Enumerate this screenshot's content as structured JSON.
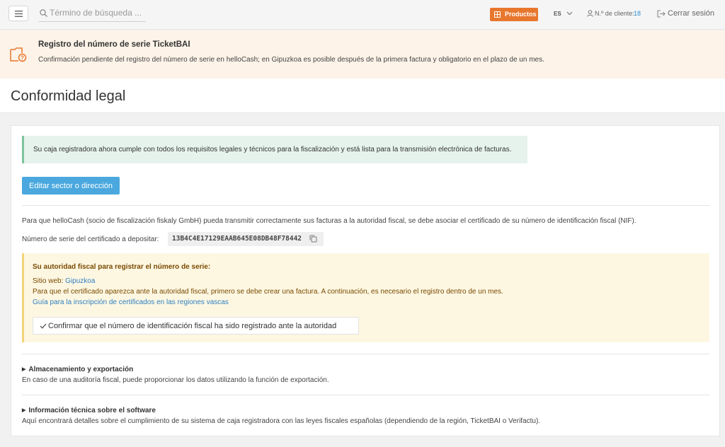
{
  "header": {
    "search_placeholder": "Término de búsqueda ...",
    "products_label": "Productos",
    "language": "ES",
    "customer_label": "N.º de cliente:",
    "customer_number": "18",
    "logout_label": "Cerrar sesión"
  },
  "notice": {
    "title": "Registro del número de serie TicketBAI",
    "text": "Confirmación pendiente del registro del número de serie en helloCash; en Gipuzkoa es posible después de la primera factura y obligatorio en el plazo de un mes."
  },
  "page": {
    "title": "Conformidad legal"
  },
  "content": {
    "success_message": "Su caja registradora ahora cumple con todos los requisitos legales y técnicos para la fiscalización y está lista para la transmisión electrónica de facturas.",
    "edit_button": "Editar sector o dirección",
    "info_text": "Para que helloCash (socio de fiscalización fiskaly GmbH) pueda transmitir correctamente sus facturas a la autoridad fiscal, se debe asociar el certificado de su número de identificación fiscal (NIF).",
    "serial_label": "Número de serie del certificado a depositar:",
    "serial_number": "13B4C4E17129EAAB645E08DB48F78442"
  },
  "authority": {
    "title": "Su autoridad fiscal para registrar el número de serie:",
    "website_label": "Sitio web:",
    "website_link": "Gipuzkoa",
    "note": "Para que el certificado aparezca ante la autoridad fiscal, primero se debe crear una factura. A continuación, es necesario el registro dentro de un mes.",
    "guide_link": "Guía para la inscripción de certificados en las regiones vascas",
    "confirm_button": "Confirmar que el número de identificación fiscal ha sido registrado ante la autoridad"
  },
  "sections": [
    {
      "title": "Almacenamiento y exportación",
      "description": "En caso de una auditoría fiscal, puede proporcionar los datos utilizando la función de exportación."
    },
    {
      "title": "Información técnica sobre el software",
      "description": "Aquí encontrará detalles sobre el cumplimiento de su sistema de caja registradora con las leyes fiscales españolas (dependiendo de la región, TicketBAI o Verifactu)."
    }
  ],
  "colors": {
    "accent_orange": "#e8772e",
    "primary_blue": "#4aa8de",
    "success_bg": "#e6f3ec",
    "warning_bg": "#fdf7e2",
    "notice_bg": "#fdf3e8"
  }
}
